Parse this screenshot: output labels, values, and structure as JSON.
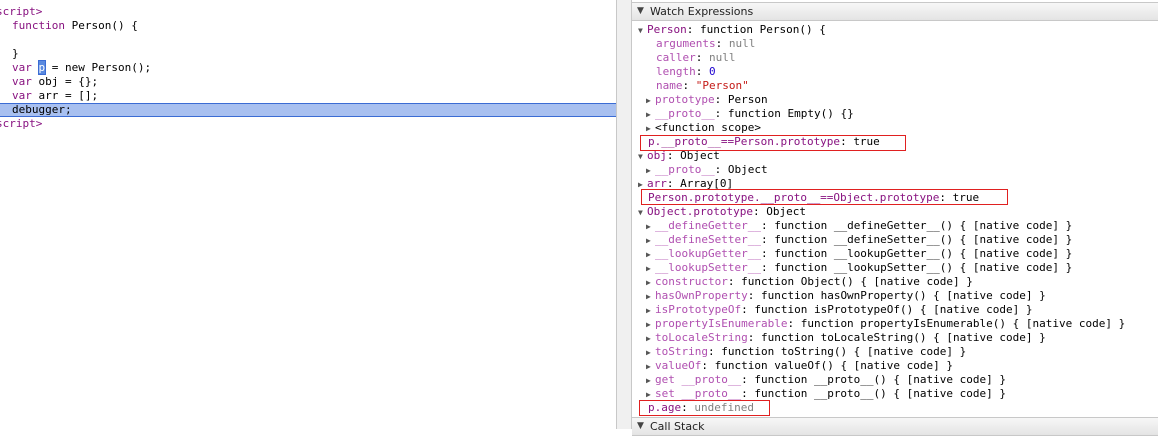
{
  "source": {
    "lines": [
      {
        "tag": "script>"
      },
      {
        "kw": "function",
        "rest": " Person() {"
      },
      {
        "text": ""
      },
      {
        "text": "}"
      },
      {
        "kw": "var",
        "sel": "p",
        "rest": " = new Person();"
      },
      {
        "kw": "var",
        "rest": " obj = {};"
      },
      {
        "kw": "var",
        "rest": " arr = [];"
      },
      {
        "text": "debugger;"
      },
      {
        "tag": "script>"
      }
    ],
    "new_kw": "new"
  },
  "watch": {
    "header": "Watch Expressions",
    "footer_header": "Call Stack",
    "rows": [
      {
        "arrow": "▼",
        "name": "Person",
        "sep": ": ",
        "value": "function Person() {"
      },
      {
        "name": "arguments",
        "sep": ": ",
        "value": "null"
      },
      {
        "name": "caller",
        "sep": ": ",
        "value": "null"
      },
      {
        "name": "length",
        "sep": ": ",
        "value": "0"
      },
      {
        "name": "name",
        "sep": ": ",
        "value": "\"Person\""
      },
      {
        "arrow": "▶",
        "name": "prototype",
        "sep": ": ",
        "value": "Person"
      },
      {
        "arrow": "▶",
        "name": "__proto__",
        "sep": ": ",
        "value": "function Empty() {}"
      },
      {
        "arrow": "▶",
        "name": "",
        "sep": "",
        "value": "<function scope>"
      },
      {
        "name": "p.__proto__==Person.prototype",
        "sep": ": ",
        "value": "true"
      },
      {
        "arrow": "▼",
        "name": "obj",
        "sep": ": ",
        "value": "Object"
      },
      {
        "arrow": "▶",
        "name": "__proto__",
        "sep": ": ",
        "value": "Object"
      },
      {
        "arrow": "▶",
        "name": "arr",
        "sep": ": ",
        "value": "Array[0]"
      },
      {
        "name": "Person.prototype.__proto__==Object.prototype",
        "sep": ": ",
        "value": "true"
      },
      {
        "arrow": "▼",
        "name": "Object.prototype",
        "sep": ": ",
        "value": "Object"
      },
      {
        "arrow": "▶",
        "name": "__defineGetter__",
        "sep": ": ",
        "value": "function __defineGetter__() { [native code] }"
      },
      {
        "arrow": "▶",
        "name": "__defineSetter__",
        "sep": ": ",
        "value": "function __defineSetter__() { [native code] }"
      },
      {
        "arrow": "▶",
        "name": "__lookupGetter__",
        "sep": ": ",
        "value": "function __lookupGetter__() { [native code] }"
      },
      {
        "arrow": "▶",
        "name": "__lookupSetter__",
        "sep": ": ",
        "value": "function __lookupSetter__() { [native code] }"
      },
      {
        "arrow": "▶",
        "name": "constructor",
        "sep": ": ",
        "value": "function Object() { [native code] }"
      },
      {
        "arrow": "▶",
        "name": "hasOwnProperty",
        "sep": ": ",
        "value": "function hasOwnProperty() { [native code] }"
      },
      {
        "arrow": "▶",
        "name": "isPrototypeOf",
        "sep": ": ",
        "value": "function isPrototypeOf() { [native code] }"
      },
      {
        "arrow": "▶",
        "name": "propertyIsEnumerable",
        "sep": ": ",
        "value": "function propertyIsEnumerable() { [native code] }"
      },
      {
        "arrow": "▶",
        "name": "toLocaleString",
        "sep": ": ",
        "value": "function toLocaleString() { [native code] }"
      },
      {
        "arrow": "▶",
        "name": "toString",
        "sep": ": ",
        "value": "function toString() { [native code] }"
      },
      {
        "arrow": "▶",
        "name": "valueOf",
        "sep": ": ",
        "value": "function valueOf() { [native code] }"
      },
      {
        "arrow": "▶",
        "name": "get __proto__",
        "sep": ": ",
        "value": "function __proto__() { [native code] }"
      },
      {
        "arrow": "▶",
        "name": "set __proto__",
        "sep": ": ",
        "value": "function __proto__() { [native code] }"
      },
      {
        "name": "p.age",
        "sep": ": ",
        "value": "undefined"
      }
    ]
  }
}
